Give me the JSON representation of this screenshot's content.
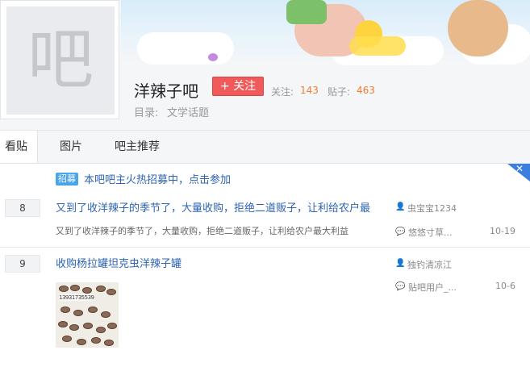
{
  "forum": {
    "avatar_char": "吧",
    "name": "洋辣子吧",
    "follow_label": "+ 关注",
    "follow_count_label": "关注:",
    "follow_count": "143",
    "post_count_label": "贴子:",
    "post_count": "463",
    "directory_label": "目录:",
    "directory_value": "文学话题"
  },
  "tabs": [
    "看贴",
    "图片",
    "吧主推荐"
  ],
  "recruit": {
    "badge": "招募",
    "text": "本吧吧主火热招募中，点击参加"
  },
  "threads": [
    {
      "reply_count": "8",
      "title": "又到了收洋辣子的季节了，大量收购，拒绝二道贩子，让利给农户最",
      "abstract": "又到了收洋辣子的季节了，大量收购，拒绝二道贩子，让利给农户最大利益",
      "author": "虫宝宝1234",
      "last_reply_user": "悠悠寸草...",
      "last_reply_time": "10-19"
    },
    {
      "reply_count": "9",
      "title": "收购杨拉罐坦克虫洋辣子罐",
      "author": "独钓清凉江",
      "last_reply_user": "贴吧用户_...",
      "last_reply_time": "10-6",
      "image_text": "13931735539"
    }
  ],
  "colors": {
    "link": "#2d64b3",
    "follow_button": "#f05a5a",
    "count_orange": "#f07c35",
    "recruit_badge": "#4aa5e8"
  }
}
